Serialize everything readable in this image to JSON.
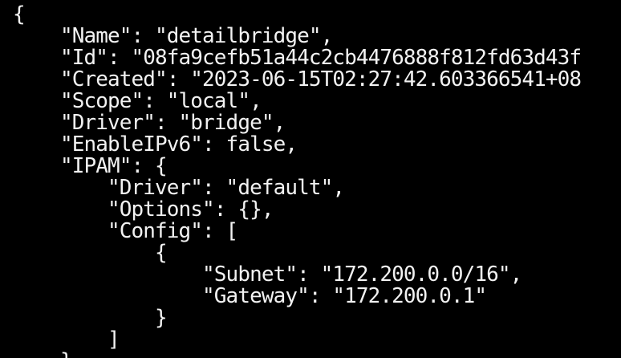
{
  "terminal": {
    "lines": [
      "{",
      "    \"Name\": \"detailbridge\",",
      "    \"Id\": \"08fa9cefb51a44c2cb4476888f812fd63d43f",
      "    \"Created\": \"2023-06-15T02:27:42.603366541+08",
      "    \"Scope\": \"local\",",
      "    \"Driver\": \"bridge\",",
      "    \"EnableIPv6\": false,",
      "    \"IPAM\": {",
      "        \"Driver\": \"default\",",
      "        \"Options\": {},",
      "        \"Config\": [",
      "            {",
      "                \"Subnet\": \"172.200.0.0/16\",",
      "                \"Gateway\": \"172.200.0.1\"",
      "            }",
      "        ]",
      "    },"
    ]
  }
}
